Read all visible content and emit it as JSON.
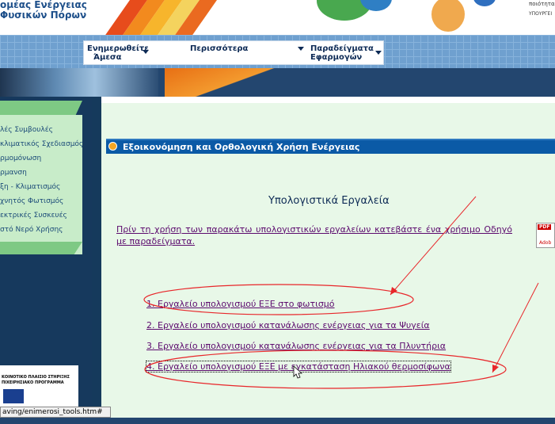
{
  "header": {
    "org_line1": "ομέας Ενέργειας",
    "org_line2": "Φυσικών Πόρων",
    "right_text": "ποιότητα",
    "ministry": "ΥΠΟΥΡΓΕΙ"
  },
  "menu": {
    "items": [
      {
        "label_line1": "Ενημερωθείτε",
        "label_line2": "Άμεσα"
      },
      {
        "label_line1": "Περισσότερα",
        "label_line2": ""
      },
      {
        "label_line1": "Παραδείγματα",
        "label_line2": "Εφαρμογών"
      }
    ]
  },
  "sidebar": {
    "items": [
      "λές Συμβουλές",
      "κλιματικός Σχεδιασμός",
      "ρμομόνωση",
      "ρμανση",
      "ξη - Κλιματισμός",
      "χνητός Φωτισμός",
      "εκτρικές Συσκευές",
      "στό Νερό Χρήσης"
    ]
  },
  "eu_banner": {
    "line1": "ΚΟΙΝΟΤΙΚΟ ΠΛΑΙΣΙΟ ΣΤΗΡΙΞΗΣ",
    "line2": "ΠΙΧΕΙΡΗΣΙΑΚΟ ΠΡΟΓΡΑΜΜΑ"
  },
  "content": {
    "section_title": "Εξοικονόμηση και Ορθολογική Χρήση Ενέργειας",
    "heading": "Υπολογιστικά Εργαλεία",
    "intro_link": "Πρίν τη χρήση των παρακάτω υπολογιστικών εργαλείων κατεβάστε ένα χρήσιμο Οδηγό με παραδείγματα.",
    "pdf_label": "PDF",
    "pdf_brand": "Adob",
    "tools": [
      "1. Εργαλείο υπολογισμού ΕΞΕ στο φωτισμό",
      "2. Εργαλείο υπολογισμού κατανάλωσης ενέργειας για τα Ψυγεία",
      "3. Εργαλείο υπολογισμού κατανάλωσης ενέργειας για τα Πλυντήρια",
      "4. Εργαλείο υπολογισμού ΕΞΕ με εγκατάσταση Ηλιακού θερμοσίφωνα"
    ]
  },
  "status_bar": {
    "url": "aving/enimerosi_tools.htm#"
  },
  "colors": {
    "link": "#5c0a6e",
    "accent_bar": "#0b5aa6",
    "annotation": "#e8262a",
    "sidebar_bg": "#c8ecc9"
  }
}
